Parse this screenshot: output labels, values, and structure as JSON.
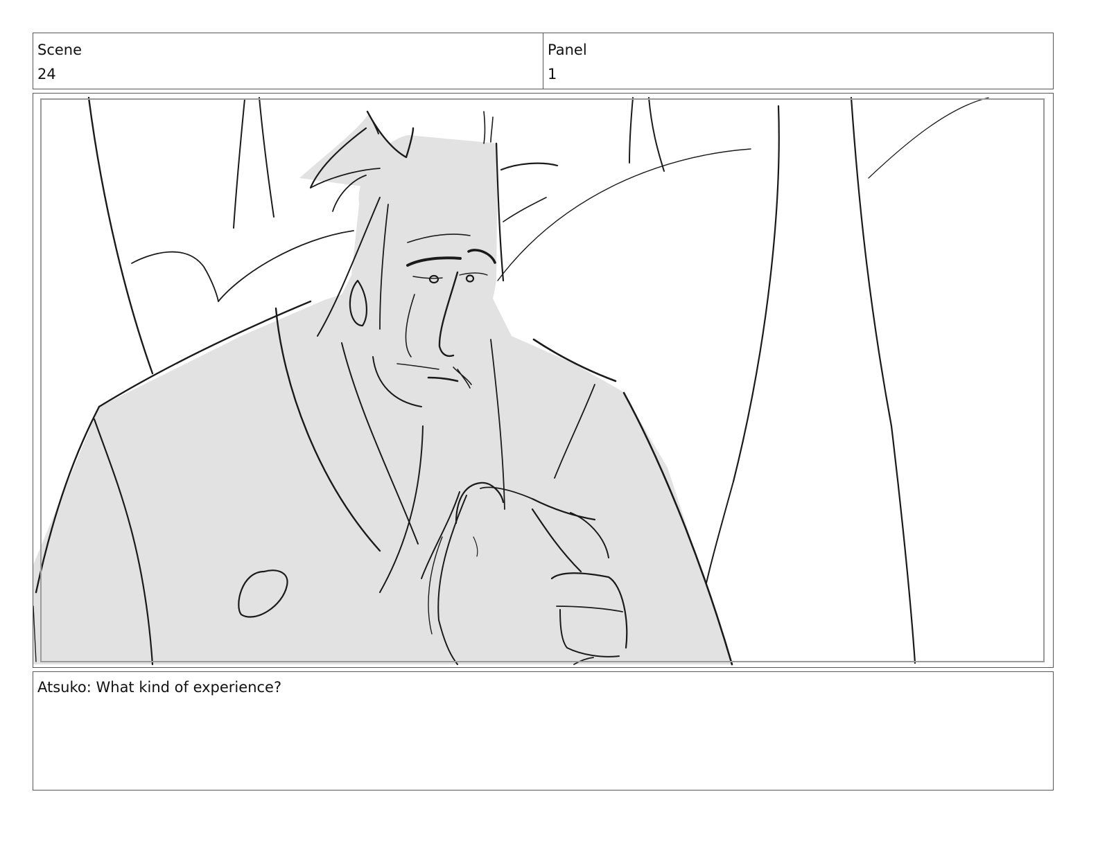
{
  "header": {
    "scene_label": "Scene",
    "scene_value": "24",
    "panel_label": "Panel",
    "panel_value": "1"
  },
  "frame": {
    "content": "storyboard-sketch"
  },
  "caption": {
    "text": "Atsuko: What kind of experience?"
  }
}
